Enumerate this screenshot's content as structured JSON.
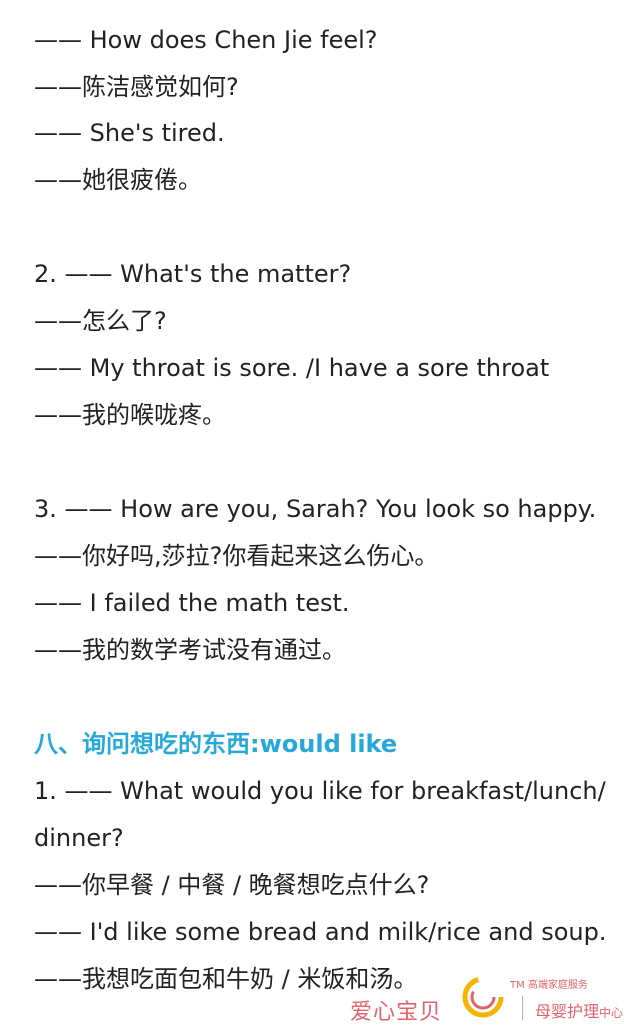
{
  "section_1": {
    "l1": "—— How does Chen Jie feel?",
    "l2": "——陈洁感觉如何?",
    "l3": "—— She's tired.",
    "l4": "——她很疲倦。"
  },
  "section_2": {
    "l1": "2.  —— What's the matter?",
    "l2": "——怎么了?",
    "l3": "—— My throat is sore. /I have a sore throat",
    "l4": "——我的喉咙疼。"
  },
  "section_3": {
    "l1": "3.  —— How are you, Sarah? You look so happy.",
    "l2": "——你好吗,莎拉?你看起来这么伤心。",
    "l3": "—— I failed the math test.",
    "l4": "——我的数学考试没有通过。"
  },
  "section_8": {
    "heading": "八、询问想吃的东西:would like",
    "l1": "1.  —— What would you like for breakfast/lunch/",
    "l2": "dinner?",
    "l3": "——你早餐 / 中餐 / 晚餐想吃点什么?",
    "l4": "—— I'd like some bread and milk/rice and soup.",
    "l5": "——我想吃面包和牛奶 / 米饭和汤。"
  },
  "watermark": {
    "left_text": "爱心宝贝",
    "tm": "TM 高端家庭服务",
    "right_main": "母婴护理",
    "right_small": "中心"
  },
  "colors": {
    "heading": "#26a9d8",
    "watermark": "#e2636b"
  }
}
